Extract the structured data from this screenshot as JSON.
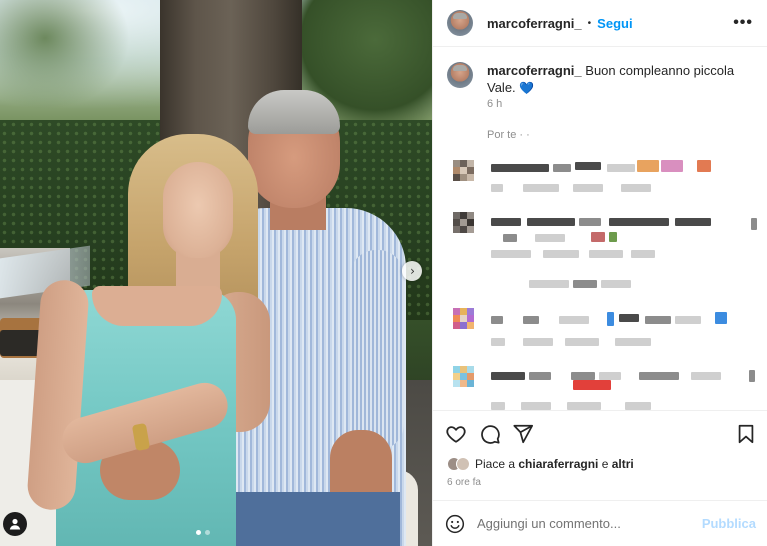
{
  "post": {
    "username": "marcoferragni_",
    "separator": "•",
    "follow_label": "Segui",
    "more_label": "•••",
    "carousel_next_glyph": "›",
    "caption_username": "marcoferragni_",
    "caption_text": " Buon compleanno piccola Vale. ",
    "caption_emoji": "💙",
    "caption_time": "6 h",
    "see_translation": "Por te · ·"
  },
  "likes": {
    "prefix": "Piace a ",
    "user": "chiaraferragni",
    "middle": " e ",
    "suffix": "altri"
  },
  "timestamp": "6 ore fa",
  "comment": {
    "placeholder": "Aggiungi un commento...",
    "publish_label": "Pubblica"
  },
  "icons": {
    "like": "heart-icon",
    "comment": "comment-icon",
    "share": "share-icon",
    "save": "bookmark-icon",
    "emoji": "emoji-icon",
    "more": "more-icon",
    "next": "chevron-right-icon",
    "user_tag": "user-tag-icon"
  },
  "colors": {
    "accent": "#0095f6",
    "publish_disabled": "#b3dbff",
    "text": "#262626",
    "muted": "#8e8e8e",
    "border": "#efefef"
  }
}
